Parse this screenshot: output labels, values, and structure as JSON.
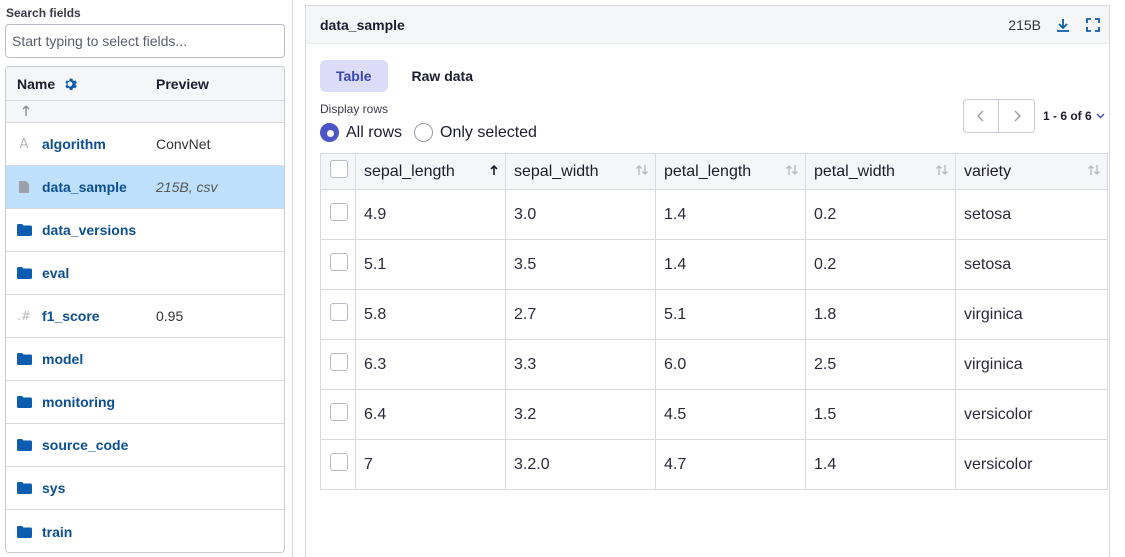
{
  "search": {
    "label": "Search fields",
    "placeholder": "Start typing to select fields..."
  },
  "fields_table": {
    "col_name": "Name",
    "col_preview": "Preview",
    "up_glyph": "↰",
    "rows": [
      {
        "icon": "text-icon",
        "name": "algorithm",
        "preview": "ConvNet"
      },
      {
        "icon": "file-icon",
        "name": "data_sample",
        "preview": "215B, csv",
        "selected": true
      },
      {
        "icon": "folder-icon",
        "name": "data_versions",
        "preview": ""
      },
      {
        "icon": "folder-icon",
        "name": "eval",
        "preview": ""
      },
      {
        "icon": "number-icon",
        "name": "f1_score",
        "preview": "0.95"
      },
      {
        "icon": "folder-icon",
        "name": "model",
        "preview": ""
      },
      {
        "icon": "folder-icon",
        "name": "monitoring",
        "preview": ""
      },
      {
        "icon": "folder-icon",
        "name": "source_code",
        "preview": ""
      },
      {
        "icon": "folder-icon",
        "name": "sys",
        "preview": ""
      },
      {
        "icon": "folder-icon",
        "name": "train",
        "preview": ""
      }
    ]
  },
  "viewer": {
    "title": "data_sample",
    "size": "215B",
    "tabs": [
      "Table",
      "Raw data"
    ],
    "active_tab": "Table",
    "display_rows_label": "Display rows",
    "radio_all": "All rows",
    "radio_selected": "Only selected",
    "pagination": "1 - 6 of 6",
    "columns": [
      "sepal_length",
      "sepal_width",
      "petal_length",
      "petal_width",
      "variety"
    ],
    "rows": [
      [
        "4.9",
        "3.0",
        "1.4",
        "0.2",
        "setosa"
      ],
      [
        "5.1",
        "3.5",
        "1.4",
        "0.2",
        "setosa"
      ],
      [
        "5.8",
        "2.7",
        "5.1",
        "1.8",
        "virginica"
      ],
      [
        "6.3",
        "3.3",
        "6.0",
        "2.5",
        "virginica"
      ],
      [
        "6.4",
        "3.2",
        "4.5",
        "1.5",
        "versicolor"
      ],
      [
        "7",
        "3.2.0",
        "4.7",
        "1.4",
        "versicolor"
      ]
    ]
  },
  "colors": {
    "accent": "#3b46b8",
    "link": "#0c4f93",
    "selected_row": "#bfe0fb",
    "folder": "#0c5db0"
  }
}
